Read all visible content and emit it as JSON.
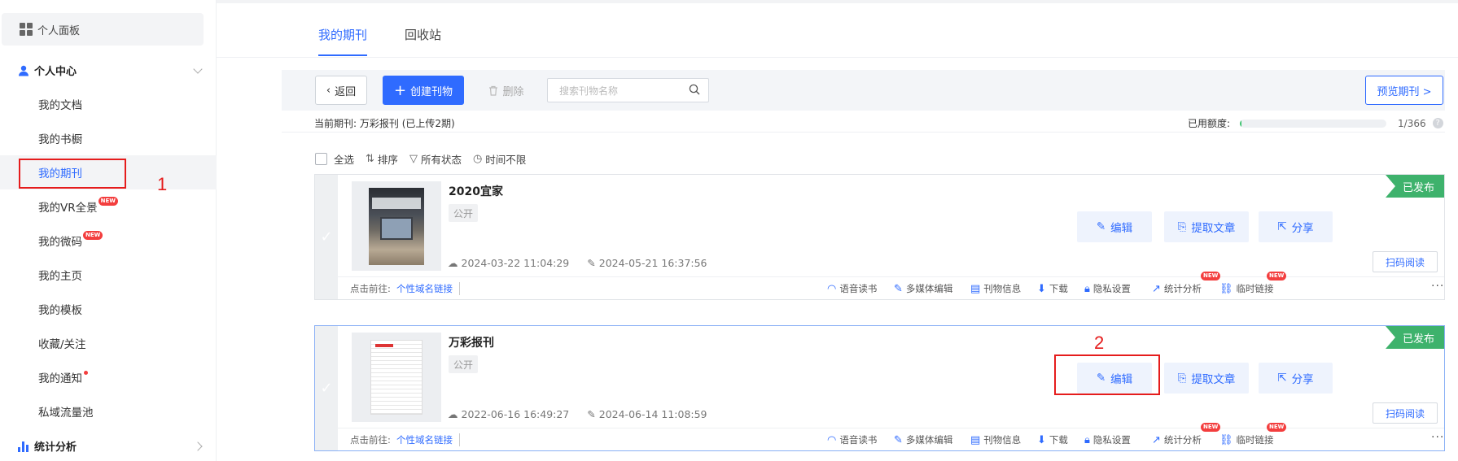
{
  "sidebar": {
    "panel_label": "个人面板",
    "group_personal": "个人中心",
    "items": [
      {
        "label": "我的文档"
      },
      {
        "label": "我的书橱"
      },
      {
        "label": "我的期刊"
      },
      {
        "label": "我的VR全景",
        "badge": "NEW"
      },
      {
        "label": "我的微码",
        "badge": "NEW"
      },
      {
        "label": "我的主页"
      },
      {
        "label": "我的模板"
      },
      {
        "label": "收藏/关注"
      },
      {
        "label": "我的通知"
      },
      {
        "label": "私域流量池"
      }
    ],
    "group_stats": "统计分析"
  },
  "annotations": {
    "step1": "1",
    "step2": "2"
  },
  "tabs": [
    {
      "label": "我的期刊"
    },
    {
      "label": "回收站"
    }
  ],
  "toolbar": {
    "back_label": "返回",
    "create_label": "创建刊物",
    "delete_label": "删除",
    "search_placeholder": "搜索刊物名称",
    "preview_label": "预览期刊 >"
  },
  "info": {
    "current_label": "当前期刊:",
    "current_value": "万彩报刊",
    "uploaded": "(已上传2期)"
  },
  "quota": {
    "label": "已用额度:",
    "used": 1,
    "total": 366,
    "count_text": "1/366",
    "help": "?"
  },
  "filters": {
    "select_all": "全选",
    "sort": "排序",
    "status": "所有状态",
    "time": "时间不限"
  },
  "colors": {
    "accent": "#2f6bff",
    "published": "#3eb26c",
    "badge": "#f33e3e",
    "annotation": "#e51c1c"
  },
  "cards": [
    {
      "title": "2020宜家",
      "visibility": "公开",
      "created": "2024-03-22 11:04:29",
      "updated": "2024-05-21 16:37:56",
      "status": "已发布",
      "cover_icon": "ikea-cover-image"
    },
    {
      "title": "万彩报刊",
      "visibility": "公开",
      "created": "2022-06-16 16:49:27",
      "updated": "2024-06-14 11:08:59",
      "status": "已发布",
      "cover_icon": "newspaper-cover-image"
    }
  ],
  "card_actions": {
    "edit": "编辑",
    "extract": "提取文章",
    "share": "分享",
    "scan": "扫码阅读"
  },
  "card_footer": {
    "goto_label": "点击前往:",
    "domain_link": "个性域名链接",
    "voice": "语音读书",
    "media_edit": "多媒体编辑",
    "info": "刊物信息",
    "download": "下载",
    "privacy": "隐私设置",
    "stats": "统计分析",
    "temp_link": "临时链接",
    "new_badge": "NEW",
    "more": "···"
  }
}
